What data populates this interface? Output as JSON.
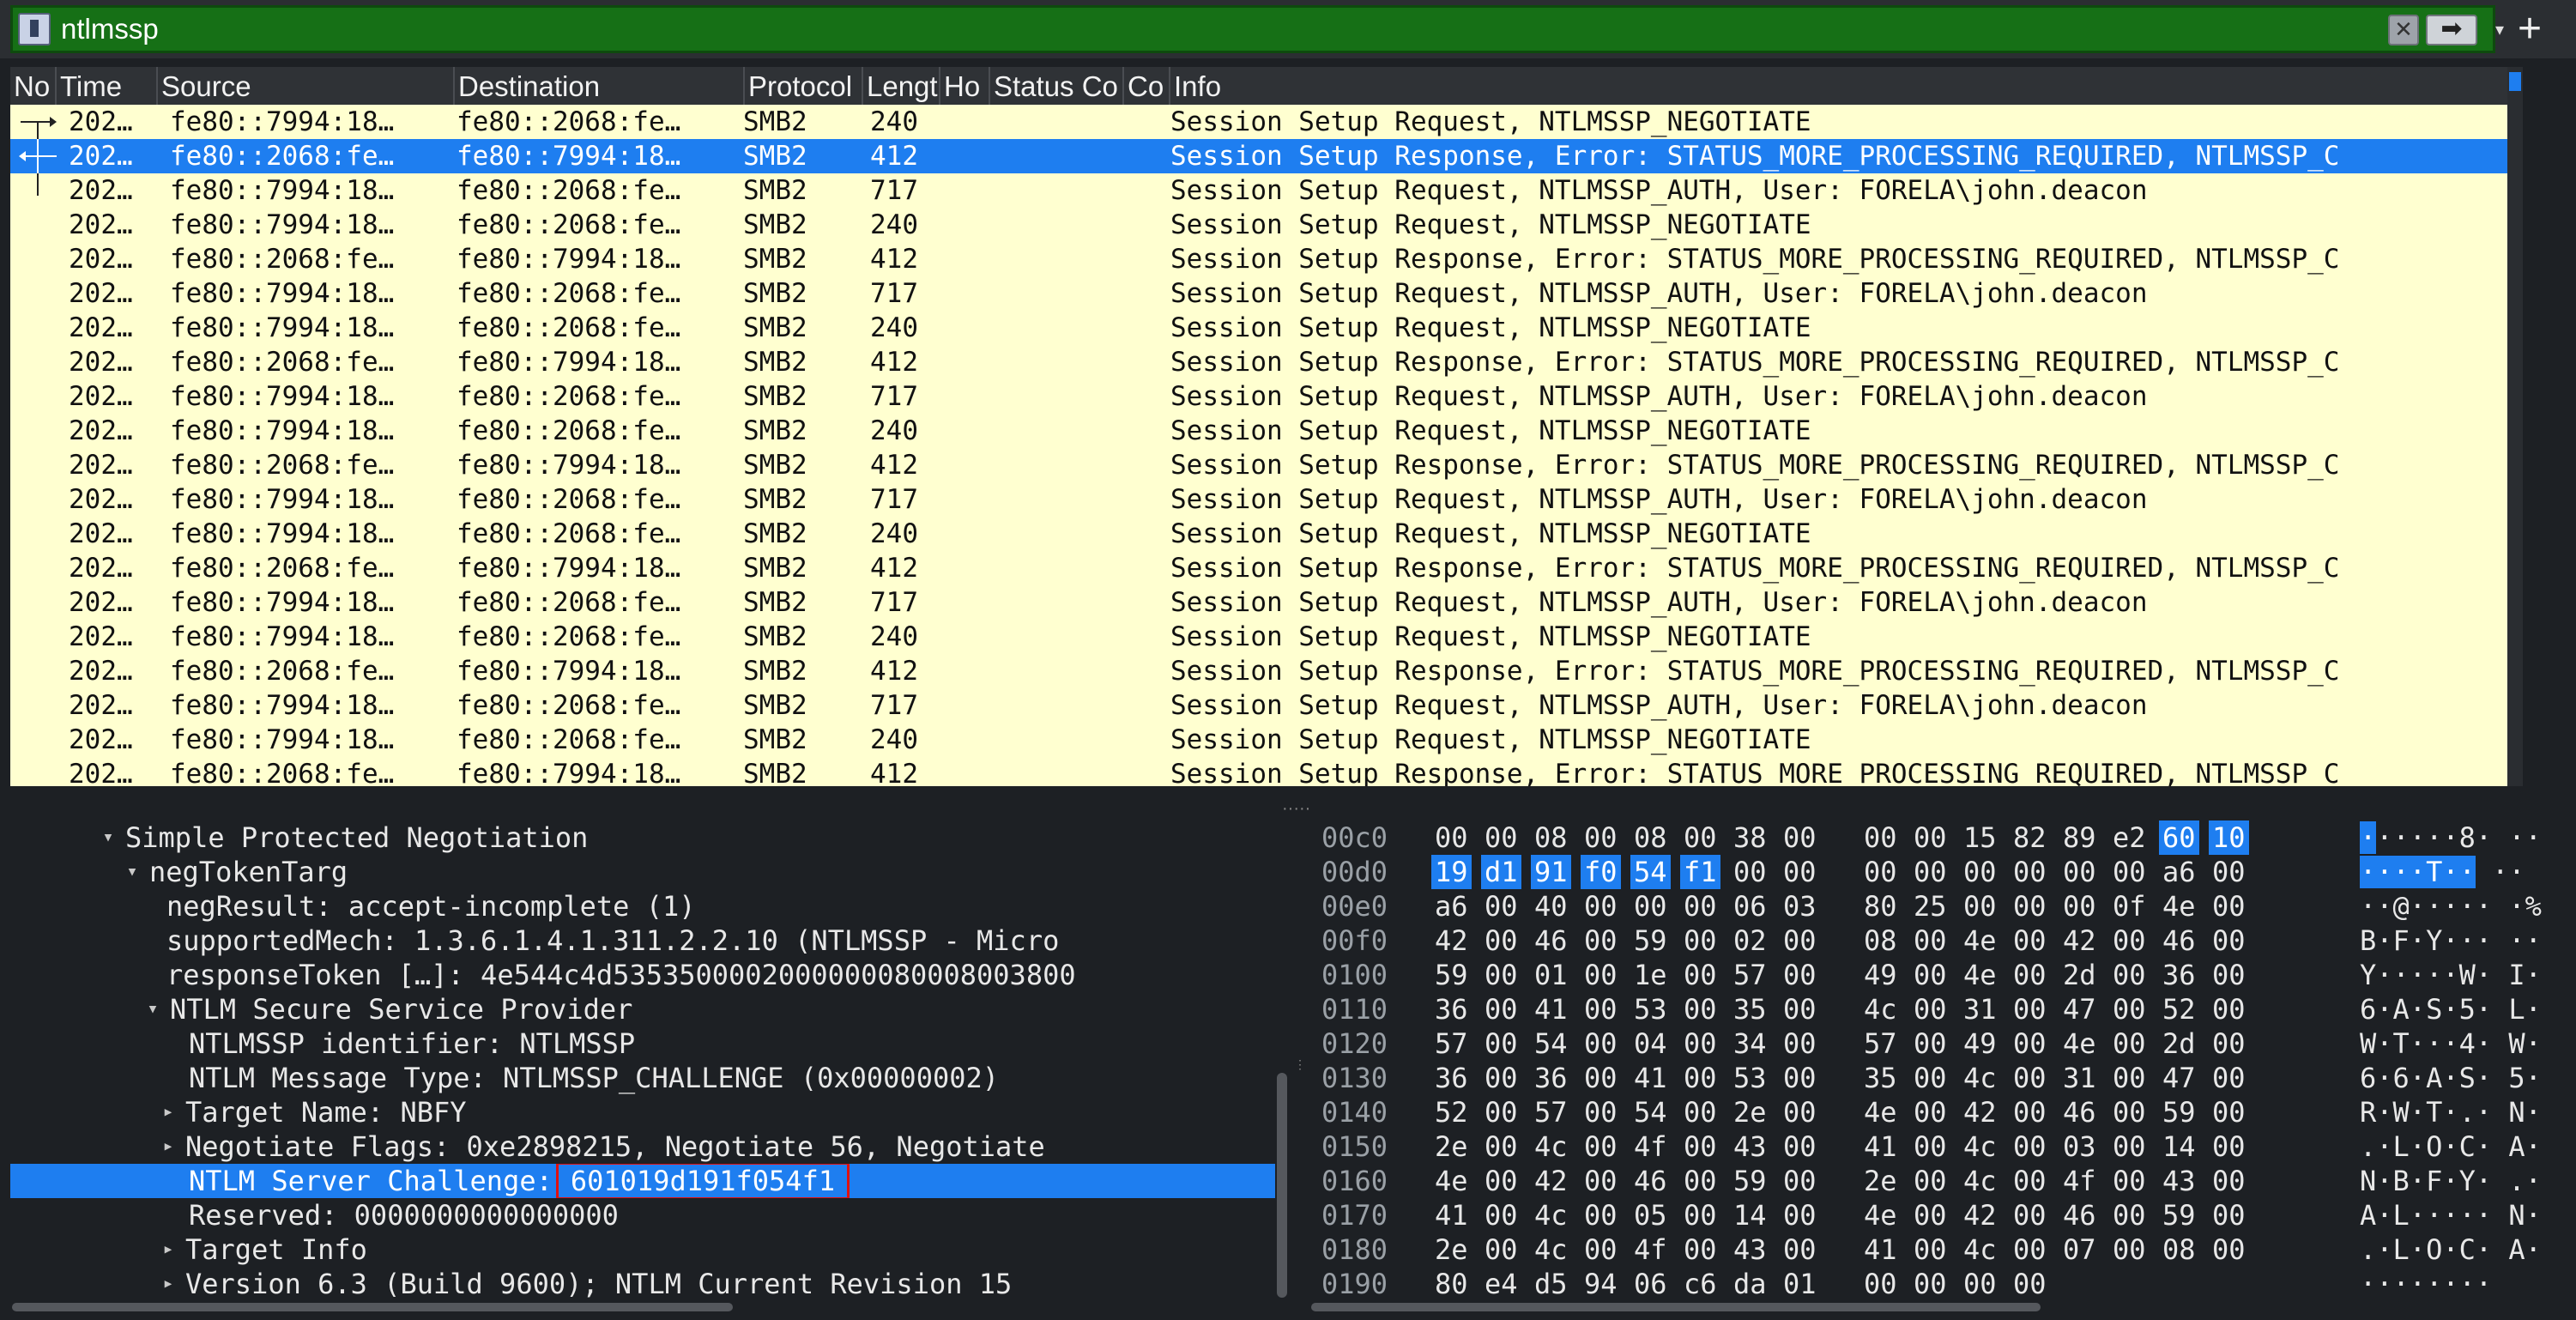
{
  "filter": {
    "value": "ntlmssp",
    "clear_label": "✕",
    "apply_label": "➡",
    "dropdown_label": "▾",
    "add_label": "+"
  },
  "packet_list": {
    "columns": [
      "No",
      "Time",
      "Source",
      "Destination",
      "Protocol",
      "Lengt",
      "Ho",
      "Status Co",
      "Co",
      "Info"
    ],
    "rows": [
      {
        "time": "202…",
        "src": "fe80::7994:18…",
        "dst": "fe80::2068:fe…",
        "proto": "SMB2",
        "len": "240",
        "info": "Session Setup Request, NTLMSSP_NEGOTIATE",
        "mark": "request"
      },
      {
        "time": "202…",
        "src": "fe80::2068:fe…",
        "dst": "fe80::7994:18…",
        "proto": "SMB2",
        "len": "412",
        "info": "Session Setup Response, Error: STATUS_MORE_PROCESSING_REQUIRED, NTLMSSP_C",
        "mark": "response",
        "selected": true
      },
      {
        "time": "202…",
        "src": "fe80::7994:18…",
        "dst": "fe80::2068:fe…",
        "proto": "SMB2",
        "len": "717",
        "info": "Session Setup Request, NTLMSSP_AUTH, User: FORELA\\john.deacon",
        "mark": "line"
      },
      {
        "time": "202…",
        "src": "fe80::7994:18…",
        "dst": "fe80::2068:fe…",
        "proto": "SMB2",
        "len": "240",
        "info": "Session Setup Request, NTLMSSP_NEGOTIATE"
      },
      {
        "time": "202…",
        "src": "fe80::2068:fe…",
        "dst": "fe80::7994:18…",
        "proto": "SMB2",
        "len": "412",
        "info": "Session Setup Response, Error: STATUS_MORE_PROCESSING_REQUIRED, NTLMSSP_C"
      },
      {
        "time": "202…",
        "src": "fe80::7994:18…",
        "dst": "fe80::2068:fe…",
        "proto": "SMB2",
        "len": "717",
        "info": "Session Setup Request, NTLMSSP_AUTH, User: FORELA\\john.deacon"
      },
      {
        "time": "202…",
        "src": "fe80::7994:18…",
        "dst": "fe80::2068:fe…",
        "proto": "SMB2",
        "len": "240",
        "info": "Session Setup Request, NTLMSSP_NEGOTIATE"
      },
      {
        "time": "202…",
        "src": "fe80::2068:fe…",
        "dst": "fe80::7994:18…",
        "proto": "SMB2",
        "len": "412",
        "info": "Session Setup Response, Error: STATUS_MORE_PROCESSING_REQUIRED, NTLMSSP_C"
      },
      {
        "time": "202…",
        "src": "fe80::7994:18…",
        "dst": "fe80::2068:fe…",
        "proto": "SMB2",
        "len": "717",
        "info": "Session Setup Request, NTLMSSP_AUTH, User: FORELA\\john.deacon"
      },
      {
        "time": "202…",
        "src": "fe80::7994:18…",
        "dst": "fe80::2068:fe…",
        "proto": "SMB2",
        "len": "240",
        "info": "Session Setup Request, NTLMSSP_NEGOTIATE"
      },
      {
        "time": "202…",
        "src": "fe80::2068:fe…",
        "dst": "fe80::7994:18…",
        "proto": "SMB2",
        "len": "412",
        "info": "Session Setup Response, Error: STATUS_MORE_PROCESSING_REQUIRED, NTLMSSP_C"
      },
      {
        "time": "202…",
        "src": "fe80::7994:18…",
        "dst": "fe80::2068:fe…",
        "proto": "SMB2",
        "len": "717",
        "info": "Session Setup Request, NTLMSSP_AUTH, User: FORELA\\john.deacon"
      },
      {
        "time": "202…",
        "src": "fe80::7994:18…",
        "dst": "fe80::2068:fe…",
        "proto": "SMB2",
        "len": "240",
        "info": "Session Setup Request, NTLMSSP_NEGOTIATE"
      },
      {
        "time": "202…",
        "src": "fe80::2068:fe…",
        "dst": "fe80::7994:18…",
        "proto": "SMB2",
        "len": "412",
        "info": "Session Setup Response, Error: STATUS_MORE_PROCESSING_REQUIRED, NTLMSSP_C"
      },
      {
        "time": "202…",
        "src": "fe80::7994:18…",
        "dst": "fe80::2068:fe…",
        "proto": "SMB2",
        "len": "717",
        "info": "Session Setup Request, NTLMSSP_AUTH, User: FORELA\\john.deacon"
      },
      {
        "time": "202…",
        "src": "fe80::7994:18…",
        "dst": "fe80::2068:fe…",
        "proto": "SMB2",
        "len": "240",
        "info": "Session Setup Request, NTLMSSP_NEGOTIATE"
      },
      {
        "time": "202…",
        "src": "fe80::2068:fe…",
        "dst": "fe80::7994:18…",
        "proto": "SMB2",
        "len": "412",
        "info": "Session Setup Response, Error: STATUS_MORE_PROCESSING_REQUIRED, NTLMSSP_C"
      },
      {
        "time": "202…",
        "src": "fe80::7994:18…",
        "dst": "fe80::2068:fe…",
        "proto": "SMB2",
        "len": "717",
        "info": "Session Setup Request, NTLMSSP_AUTH, User: FORELA\\john.deacon"
      },
      {
        "time": "202…",
        "src": "fe80::7994:18…",
        "dst": "fe80::2068:fe…",
        "proto": "SMB2",
        "len": "240",
        "info": "Session Setup Request, NTLMSSP_NEGOTIATE"
      },
      {
        "time": "202…",
        "src": "fe80::2068:fe…",
        "dst": "fe80::7994:18…",
        "proto": "SMB2",
        "len": "412",
        "info": "Session Setup Response, Error: STATUS_MORE_PROCESSING_REQUIRED, NTLMSSP_C"
      }
    ]
  },
  "detail": {
    "rows": [
      {
        "arrow": "▾",
        "text": "Simple Protected Negotiation"
      },
      {
        "arrow": "▾",
        "text": "negTokenTarg"
      },
      {
        "arrow": "",
        "text": "negResult: accept-incomplete (1)"
      },
      {
        "arrow": "",
        "text": "supportedMech: 1.3.6.1.4.1.311.2.2.10 (NTLMSSP - Micro"
      },
      {
        "arrow": "",
        "text": "responseToken […]: 4e544c4d5353500002000000080008003800"
      },
      {
        "arrow": "▾",
        "text": "NTLM Secure Service Provider"
      },
      {
        "arrow": "",
        "text": "NTLMSSP identifier: NTLMSSP"
      },
      {
        "arrow": "",
        "text": "NTLM Message Type: NTLMSSP_CHALLENGE (0x00000002)"
      },
      {
        "arrow": "▸",
        "text": "Target Name: NBFY"
      },
      {
        "arrow": "▸",
        "text": "Negotiate Flags: 0xe2898215, Negotiate 56, Negotiate"
      },
      {
        "arrow": "",
        "text": "NTLM Server Challenge:",
        "value": "601019d191f054f1",
        "selected": true
      },
      {
        "arrow": "",
        "text": "Reserved: 0000000000000000"
      },
      {
        "arrow": "▸",
        "text": "Target Info"
      },
      {
        "arrow": "▸",
        "text": "Version 6.3 (Build 9600); NTLM Current Revision 15"
      }
    ]
  },
  "bytes": {
    "rows": [
      {
        "off": "00c0",
        "hex": [
          "00",
          "00",
          "08",
          "00",
          "08",
          "00",
          "38",
          "00",
          "00",
          "00",
          "15",
          "82",
          "89",
          "e2",
          "60",
          "10"
        ],
        "ascii": "······8· ··",
        "hl": [
          14,
          15
        ],
        "ahl": [
          0,
          0
        ]
      },
      {
        "off": "00d0",
        "hex": [
          "19",
          "d1",
          "91",
          "f0",
          "54",
          "f1",
          "00",
          "00",
          "00",
          "00",
          "00",
          "00",
          "00",
          "00",
          "a6",
          "00"
        ],
        "ascii": "····T·· ··",
        "hl": [
          0,
          5
        ],
        "ahl": [
          0,
          6
        ]
      },
      {
        "off": "00e0",
        "hex": [
          "a6",
          "00",
          "40",
          "00",
          "00",
          "00",
          "06",
          "03",
          "80",
          "25",
          "00",
          "00",
          "00",
          "0f",
          "4e",
          "00"
        ],
        "ascii": "··@····· ·%"
      },
      {
        "off": "00f0",
        "hex": [
          "42",
          "00",
          "46",
          "00",
          "59",
          "00",
          "02",
          "00",
          "08",
          "00",
          "4e",
          "00",
          "42",
          "00",
          "46",
          "00"
        ],
        "ascii": "B·F·Y··· ··"
      },
      {
        "off": "0100",
        "hex": [
          "59",
          "00",
          "01",
          "00",
          "1e",
          "00",
          "57",
          "00",
          "49",
          "00",
          "4e",
          "00",
          "2d",
          "00",
          "36",
          "00"
        ],
        "ascii": "Y·····W· I·"
      },
      {
        "off": "0110",
        "hex": [
          "36",
          "00",
          "41",
          "00",
          "53",
          "00",
          "35",
          "00",
          "4c",
          "00",
          "31",
          "00",
          "47",
          "00",
          "52",
          "00"
        ],
        "ascii": "6·A·S·5· L·"
      },
      {
        "off": "0120",
        "hex": [
          "57",
          "00",
          "54",
          "00",
          "04",
          "00",
          "34",
          "00",
          "57",
          "00",
          "49",
          "00",
          "4e",
          "00",
          "2d",
          "00"
        ],
        "ascii": "W·T···4· W·"
      },
      {
        "off": "0130",
        "hex": [
          "36",
          "00",
          "36",
          "00",
          "41",
          "00",
          "53",
          "00",
          "35",
          "00",
          "4c",
          "00",
          "31",
          "00",
          "47",
          "00"
        ],
        "ascii": "6·6·A·S· 5·"
      },
      {
        "off": "0140",
        "hex": [
          "52",
          "00",
          "57",
          "00",
          "54",
          "00",
          "2e",
          "00",
          "4e",
          "00",
          "42",
          "00",
          "46",
          "00",
          "59",
          "00"
        ],
        "ascii": "R·W·T·.· N·"
      },
      {
        "off": "0150",
        "hex": [
          "2e",
          "00",
          "4c",
          "00",
          "4f",
          "00",
          "43",
          "00",
          "41",
          "00",
          "4c",
          "00",
          "03",
          "00",
          "14",
          "00"
        ],
        "ascii": ".·L·O·C· A·"
      },
      {
        "off": "0160",
        "hex": [
          "4e",
          "00",
          "42",
          "00",
          "46",
          "00",
          "59",
          "00",
          "2e",
          "00",
          "4c",
          "00",
          "4f",
          "00",
          "43",
          "00"
        ],
        "ascii": "N·B·F·Y· .·"
      },
      {
        "off": "0170",
        "hex": [
          "41",
          "00",
          "4c",
          "00",
          "05",
          "00",
          "14",
          "00",
          "4e",
          "00",
          "42",
          "00",
          "46",
          "00",
          "59",
          "00"
        ],
        "ascii": "A·L····· N·"
      },
      {
        "off": "0180",
        "hex": [
          "2e",
          "00",
          "4c",
          "00",
          "4f",
          "00",
          "43",
          "00",
          "41",
          "00",
          "4c",
          "00",
          "07",
          "00",
          "08",
          "00"
        ],
        "ascii": ".·L·O·C· A·"
      },
      {
        "off": "0190",
        "hex": [
          "80",
          "e4",
          "d5",
          "94",
          "06",
          "c6",
          "da",
          "01",
          "00",
          "00",
          "00",
          "00"
        ],
        "ascii": "········"
      }
    ]
  }
}
